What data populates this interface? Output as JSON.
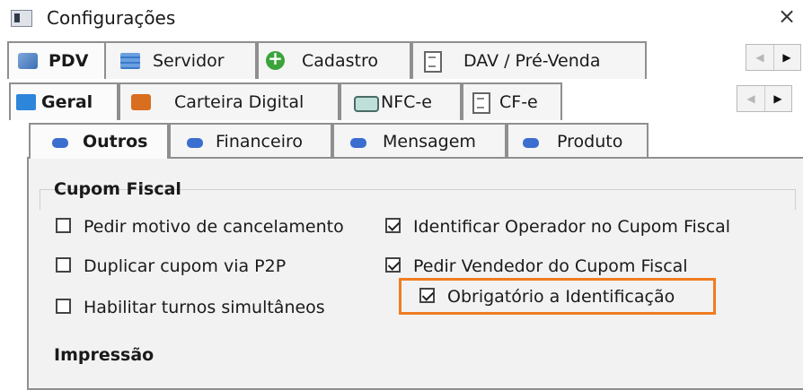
{
  "window": {
    "title": "Configurações",
    "close_glyph": "×"
  },
  "tabs_row1": [
    {
      "label": "PDV",
      "icon": "pdv-icon",
      "active": true
    },
    {
      "label": "Servidor",
      "icon": "server-icon"
    },
    {
      "label": "Cadastro",
      "icon": "add-icon"
    },
    {
      "label": "DAV / Pré-Venda",
      "icon": "document-icon"
    }
  ],
  "tabs_row2": [
    {
      "label": "Geral",
      "icon": "settings-icon",
      "active": true
    },
    {
      "label": "Carteira Digital",
      "icon": "wallet-icon"
    },
    {
      "label": "NFC-e",
      "icon": "nfce-icon"
    },
    {
      "label": "CF-e",
      "icon": "document-icon"
    }
  ],
  "tabs_row3": [
    {
      "label": "Outros",
      "icon": "pill-icon",
      "active": true
    },
    {
      "label": "Financeiro",
      "icon": "pill-icon"
    },
    {
      "label": "Mensagem",
      "icon": "pill-icon"
    },
    {
      "label": "Produto",
      "icon": "pill-icon"
    }
  ],
  "nav_arrows": {
    "left": "◀",
    "right": "▶"
  },
  "cupom_fiscal": {
    "title": "Cupom Fiscal",
    "options": [
      {
        "label": "Pedir motivo de cancelamento",
        "checked": false
      },
      {
        "label": "Duplicar cupom via P2P",
        "checked": false
      },
      {
        "label": "Habilitar turnos simultâneos",
        "checked": false
      },
      {
        "label": "Identificar Operador no Cupom Fiscal",
        "checked": true
      },
      {
        "label": "Pedir Vendedor do Cupom Fiscal",
        "checked": true
      },
      {
        "label": "Obrigatório a Identificação",
        "checked": true,
        "highlighted": true
      }
    ]
  },
  "impressao": {
    "title": "Impressão"
  },
  "colors": {
    "highlight": "#ef7d22",
    "panel": "#f2f2f2",
    "tab_border": "#8f8f8f"
  }
}
